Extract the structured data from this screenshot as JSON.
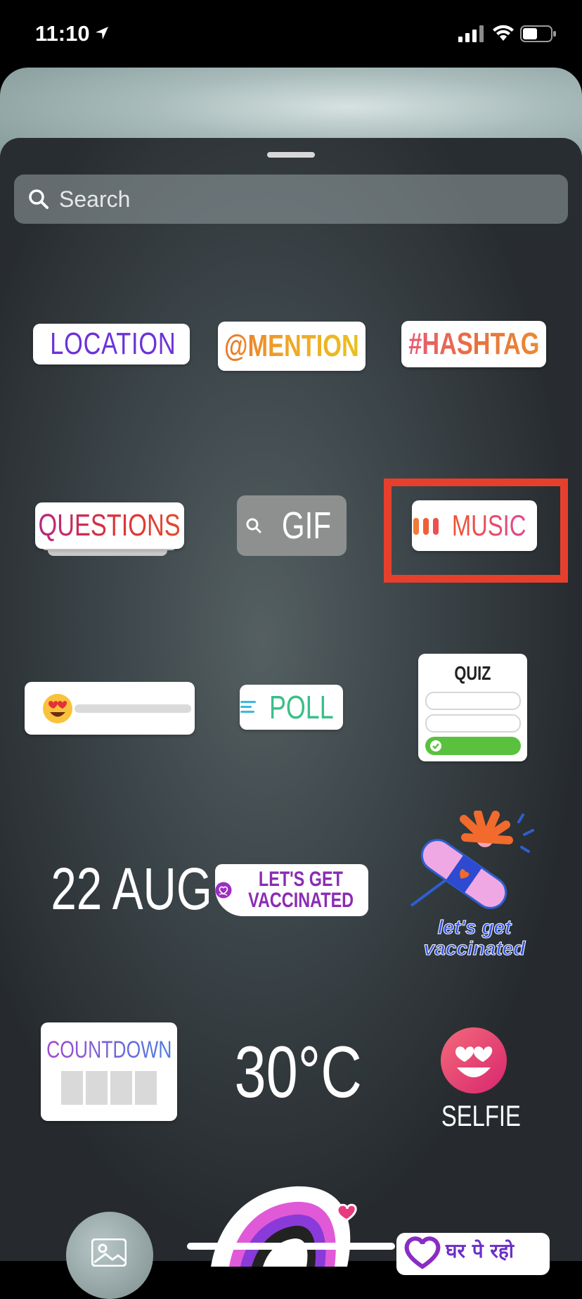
{
  "status_bar": {
    "time": "11:10"
  },
  "search": {
    "placeholder": "Search"
  },
  "stickers": {
    "location": "LOCATION",
    "mention": "@MENTION",
    "hashtag": "#HASHTAG",
    "questions": "QUESTIONS",
    "gif": "GIF",
    "music": "MUSIC",
    "poll": "POLL",
    "quiz": "QUIZ",
    "date": "22 AUG",
    "vaccinated_badge_line1": "LET'S GET",
    "vaccinated_badge_line2": "VACCINATED",
    "vaccinated_art_line1": "let's get",
    "vaccinated_art_line2": "vaccinated",
    "countdown": "COUNTDOWN",
    "temperature": "30°C",
    "selfie": "SELFIE",
    "stay_home": "घर पे रहो"
  },
  "colors": {
    "highlight": "#e6402d",
    "poll": "#3bbf8a",
    "location": "#6a33d8"
  }
}
